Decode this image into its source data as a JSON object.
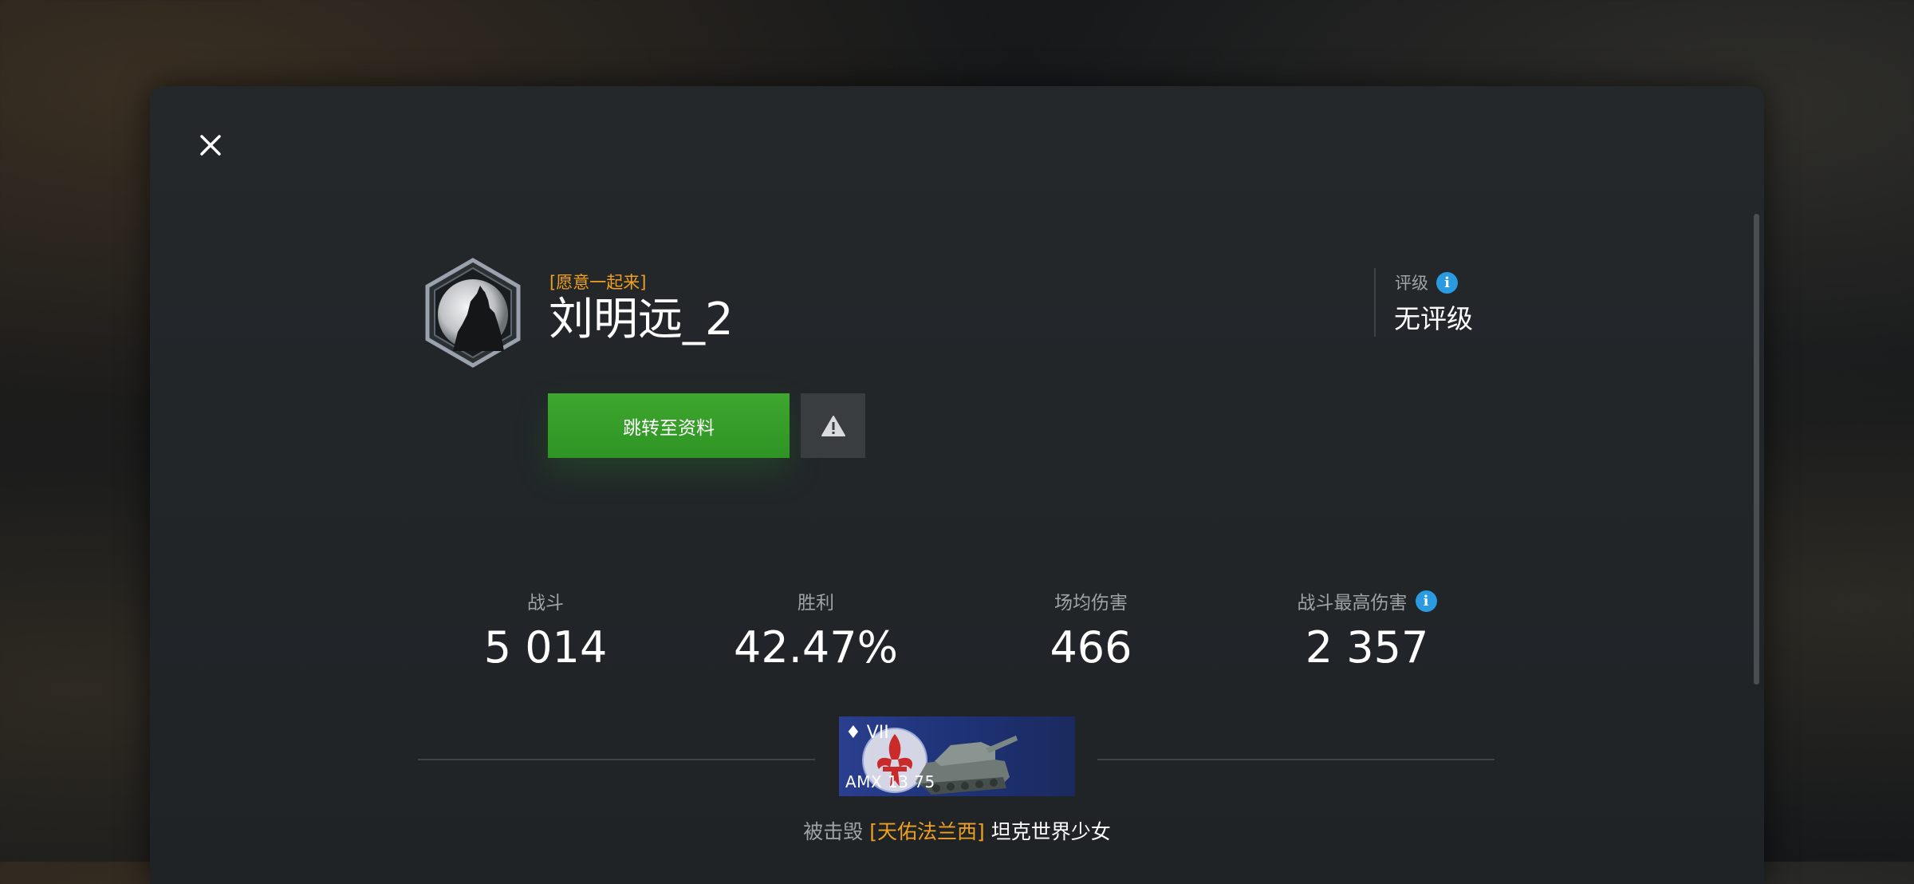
{
  "dialog": {
    "close_icon": "close-icon",
    "player": {
      "clan_tag": "[愿意一起来]",
      "nickname": "刘明远_2",
      "avatar_icon": "wolf-emblem-icon"
    },
    "buttons": {
      "profile_label": "跳转至资料",
      "report_icon": "warning-triangle-icon"
    },
    "rating": {
      "label": "评级",
      "value": "无评级",
      "info_icon": "info-icon"
    },
    "stats": [
      {
        "label": "战斗",
        "value": "5 014"
      },
      {
        "label": "胜利",
        "value": "42.47%"
      },
      {
        "label": "场均伤害",
        "value": "466"
      },
      {
        "label": "战斗最高伤害",
        "value": "2 357",
        "info_icon": "info-icon"
      }
    ],
    "destroyed_by": {
      "vehicle_tier": "♦ VII",
      "vehicle_name": "AMX 13 75",
      "label": "被击毁",
      "clan": "[天佑法兰西]",
      "player": "坦克世界少女"
    },
    "colors": {
      "accent_orange": "#f0a020",
      "button_green": "#3ea72e",
      "info_blue": "#2a9be0",
      "panel": "#222629"
    }
  }
}
